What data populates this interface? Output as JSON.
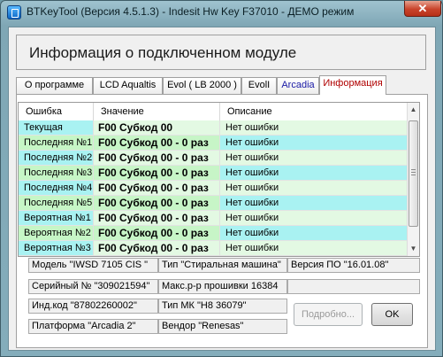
{
  "window": {
    "title": "BTKeyTool  (Версия 4.5.1.3)  -  Indesit Hw Key F37010 - ДЕМО режим"
  },
  "header": {
    "text": "Информация о подключенном модуле"
  },
  "tabs": [
    {
      "label": "О программе"
    },
    {
      "label": "LCD Aqualtis"
    },
    {
      "label": "Evol ( LB 2000 )"
    },
    {
      "label": "EvolI"
    },
    {
      "label": "Arcadia",
      "color": "#1a1aa6"
    },
    {
      "label": "Информация",
      "color": "#b00000",
      "active": true
    }
  ],
  "grid": {
    "columns": [
      "Ошибка",
      "Значение",
      "Описание"
    ],
    "rows": [
      {
        "error": "Текущая",
        "value": "F00 Субкод 00",
        "desc": "Нет ошибки"
      },
      {
        "error": "Последняя №1",
        "value": "F00 Субкод 00 - 0  раз",
        "desc": "Нет ошибки"
      },
      {
        "error": "Последняя №2",
        "value": "F00 Субкод 00 - 0  раз",
        "desc": "Нет ошибки"
      },
      {
        "error": "Последняя №3",
        "value": "F00 Субкод 00 - 0  раз",
        "desc": "Нет ошибки"
      },
      {
        "error": "Последняя №4",
        "value": "F00 Субкод 00 - 0  раз",
        "desc": "Нет ошибки"
      },
      {
        "error": "Последняя №5",
        "value": "F00 Субкод 00 - 0  раз",
        "desc": "Нет ошибки"
      },
      {
        "error": "Вероятная №1",
        "value": "F00 Субкод 00 - 0  раз",
        "desc": "Нет ошибки"
      },
      {
        "error": "Вероятная №2",
        "value": "F00 Субкод 00 - 0  раз",
        "desc": "Нет ошибки"
      },
      {
        "error": "Вероятная №3",
        "value": "F00 Субкод 00 - 0  раз",
        "desc": "Нет ошибки"
      }
    ]
  },
  "info": {
    "model": "Модель  \"IWSD 7105 CIS \"",
    "type": "Тип  \"Стиральная машина\"",
    "version": "Версия ПО  \"16.01.08\"",
    "serial": "Серийный №  \"309021594\"",
    "max_flash": "Макс.р-р прошивки  16384",
    "ind_code": "Инд.код  \"87802260002\"",
    "mc_type": "Тип МК   \"H8 36079\"",
    "platform": "Платформа  \"Arcadia 2\"",
    "vendor": "Вендор  \"Renesas\""
  },
  "buttons": {
    "details": "Подробно...",
    "ok": "OK"
  },
  "colors": {
    "row_cyan": "#a9f2f2",
    "row_green": "#c6f6c6",
    "value_light": "#e3f9e3",
    "value_green": "#c7f5c7"
  }
}
